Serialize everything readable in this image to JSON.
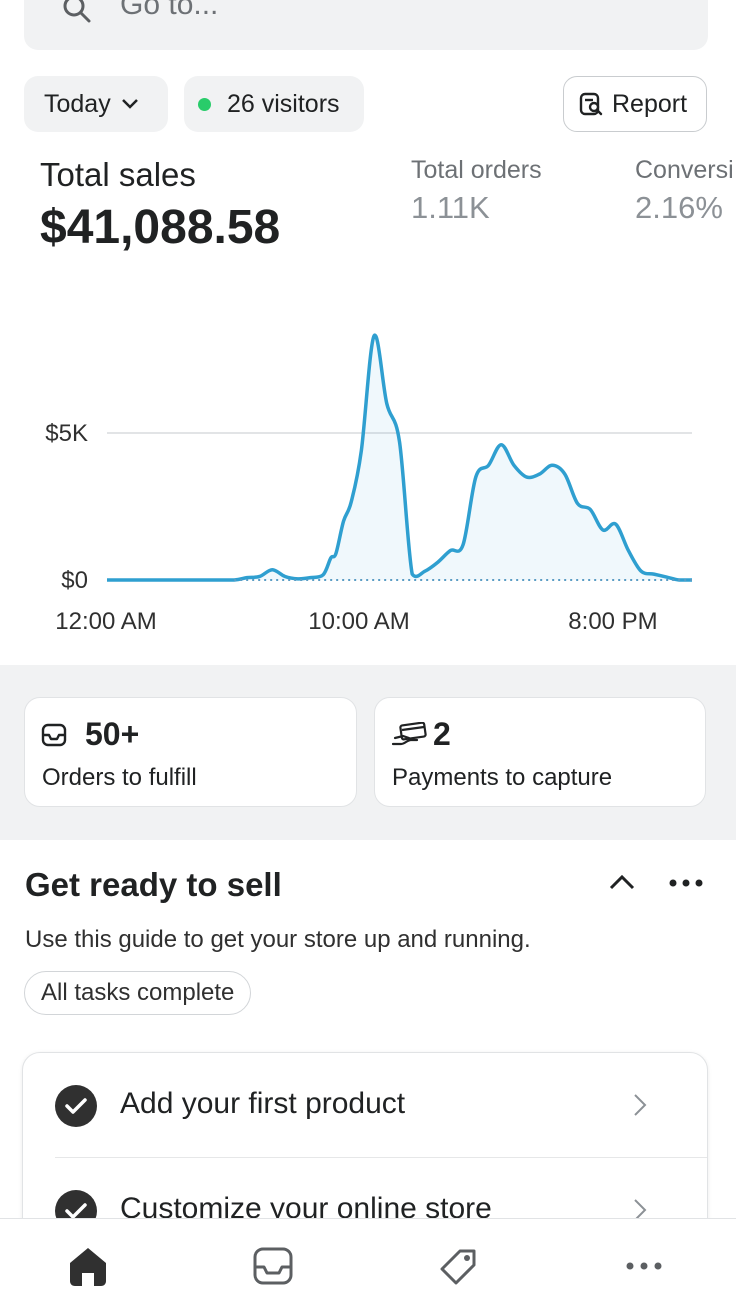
{
  "search": {
    "placeholder": "Go to..."
  },
  "filters": {
    "date_label": "Today",
    "visitors_label": "26 visitors",
    "report_label": "Report"
  },
  "metrics": {
    "total_sales_label": "Total sales",
    "total_sales_value": "$41,088.58",
    "total_orders_label": "Total orders",
    "total_orders_value": "1.11K",
    "conversion_label": "Conversi",
    "conversion_value": "2.16%"
  },
  "chart_data": {
    "type": "line",
    "title": "",
    "xlabel": "",
    "ylabel": "",
    "x_tick_labels": [
      "12:00 AM",
      "10:00 AM",
      "8:00 PM"
    ],
    "y_tick_labels": [
      "$0",
      "$5K"
    ],
    "y_tick_values": [
      0,
      5000
    ],
    "ylim": [
      0,
      8500
    ],
    "series": [
      {
        "color": "#2f9fd0",
        "x": [
          0,
          2,
          4,
          5,
          5.5,
          6,
          6.5,
          7,
          7.5,
          8,
          8.5,
          8.8,
          9,
          9.3,
          9.6,
          10,
          10.5,
          11,
          11.5,
          12,
          12.5,
          13,
          13.5,
          14,
          14.5,
          15,
          15.5,
          16,
          16.5,
          17,
          17.5,
          18,
          18.5,
          19,
          19.5,
          20,
          20.5,
          21,
          21.5,
          22,
          22.5,
          23
        ],
        "y": [
          0,
          0,
          0,
          0,
          80,
          120,
          350,
          120,
          40,
          80,
          180,
          750,
          900,
          2000,
          2650,
          4400,
          8300,
          6000,
          4700,
          200,
          300,
          600,
          1000,
          1200,
          3500,
          3900,
          4600,
          3900,
          3500,
          3600,
          3900,
          3600,
          2600,
          2400,
          1700,
          1900,
          1000,
          300,
          200,
          100,
          0,
          0
        ]
      },
      {
        "style": "dotted",
        "x": [
          5,
          7,
          9,
          11,
          13,
          15,
          17,
          19,
          21,
          23
        ],
        "y": [
          0,
          0,
          0,
          0,
          0,
          0,
          0,
          0,
          0,
          0
        ]
      }
    ],
    "grid": true
  },
  "stats": {
    "orders_count": "50+",
    "orders_label": "Orders to fulfill",
    "payments_count": "2",
    "payments_label": "Payments to capture"
  },
  "guide": {
    "title": "Get ready to sell",
    "subtitle": "Use this guide to get your store up and running.",
    "badge": "All tasks complete",
    "tasks": [
      {
        "label": "Add your first product"
      },
      {
        "label": "Customize your online store"
      }
    ]
  },
  "nav": {
    "items": [
      "home-icon",
      "orders-icon",
      "products-icon",
      "more-icon"
    ],
    "active_color": "#303030"
  }
}
